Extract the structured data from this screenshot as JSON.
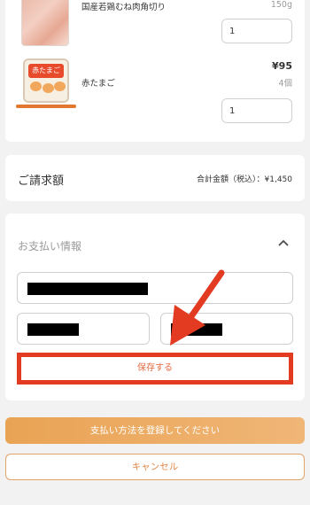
{
  "cart": {
    "items": [
      {
        "name": "国産若鶏むね肉角切り",
        "unit": "150g",
        "quantity": "1",
        "image_icon": "chicken-pack-image"
      },
      {
        "name": "赤たまご",
        "price": "¥95",
        "unit": "4個",
        "quantity": "1",
        "image_icon": "egg-pack-image",
        "image_label": "赤たまご"
      }
    ]
  },
  "billing": {
    "title": "ご請求額",
    "total_label": "合計金額（税込）：¥1,450"
  },
  "payment": {
    "title": "お支払い情報",
    "chevron_icon": "chevron-up-icon",
    "card_number_value": "",
    "expiry_value": "",
    "cvc_value": "",
    "save_label": "保存する"
  },
  "actions": {
    "register_label": "支払い方法を登録してください",
    "cancel_label": "キャンセル"
  },
  "colors": {
    "accent_orange": "#e9a354",
    "annotation_red": "#e33a22"
  }
}
